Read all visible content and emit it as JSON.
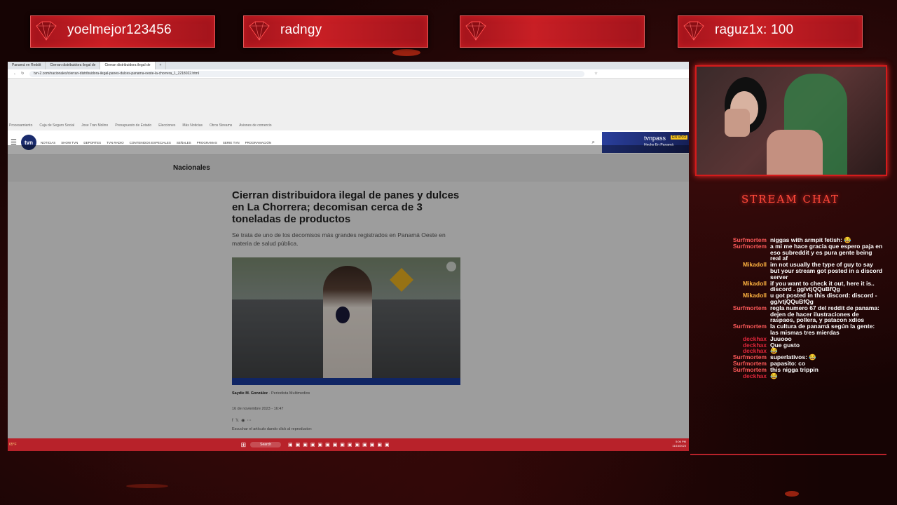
{
  "banners": [
    {
      "name": "yoelmejor123456"
    },
    {
      "name": "radngy"
    },
    {
      "name": ""
    },
    {
      "name": "raguz1x: 100"
    }
  ],
  "browser": {
    "tabs": [
      "Panamá en Reddit",
      "Cierran distribuidora ilegal de",
      "Cierran distribuidora ilegal de"
    ],
    "url": "tvn-2.com/nacionales/cierran-distribuidora-ilegal-panes-dulces-panama-oeste-la-chorrera_1_2218022.html",
    "bookmarks": [
      "Procesamiento",
      "Caja de Seguro Social",
      "Jose Tran Molino",
      "Presupuesto de Estado",
      "Elecciones",
      "Más Noticias",
      "Otros Streams",
      "Aviones de comercio"
    ],
    "nav_items": [
      "NOTICIAS",
      "SHOW TVN",
      "DEPORTES",
      "TVN RADIO",
      "CONTENIDOS ESPECIALES",
      "SEÑALES",
      "PROGRAMAS",
      "SERIE TVN",
      "PROGRAMACIÓN"
    ],
    "logo": "tvn",
    "tvnpass_label": "tvnpass",
    "tvnpass_badge": "EN VIVO",
    "tvnpass_sub": "Hecho En Panamá",
    "section": "Nacionales",
    "headline": "Cierran distribuidora ilegal de panes y dulces en La Chorrera; decomisan cerca de 3 toneladas de productos",
    "summary": "Se trata de uno de los decomisos más grandes registrados en Panamá Oeste en materia de salud pública.",
    "author": "Saydie M. González",
    "author_role": "Periodista Multimedios",
    "date": "16 de noviembre 2023 - 16:47",
    "listen": "Escuchar el artículo dando click al reproductor:",
    "taskbar_search": "Search",
    "weather": "65°F",
    "time": "5:06 PM",
    "date_short": "11/16/2023"
  },
  "chat": {
    "title": "STREAM CHAT",
    "messages": [
      {
        "user": "Surfmortem",
        "text": "niggas with armpit fetish: 😂",
        "color": "#ff5a5a"
      },
      {
        "user": "Surfmortem",
        "text": "a mi me hace gracia que espero paja en eso subreddit y es pura gente being real af",
        "color": "#ff5a5a"
      },
      {
        "user": "Mikadoll",
        "text": "im not usually the type of guy to say but your stream got posted in a discord server",
        "color": "#ffb340"
      },
      {
        "user": "Mikadoll",
        "text": "if you want to check it out, here it is.. discord . gg/vtjQQuBfQg",
        "color": "#ffb340"
      },
      {
        "user": "Mikadoll",
        "text": "u got posted in this discord: discord - gg/vtjQQuBfQg",
        "color": "#ffb340"
      },
      {
        "user": "Surfmortem",
        "text": "regla numero 67 del reddit de panama: dejen de hacer ilustraciones de raspaos, pollera, y patacon xdios",
        "color": "#ff5a5a"
      },
      {
        "user": "Surfmortem",
        "text": "la cultura de panamá según la gente: las mismas tres mierdas",
        "color": "#ff5a5a"
      },
      {
        "user": "deckhax",
        "text": "Juuooo",
        "color": "#e0263a"
      },
      {
        "user": "deckhax",
        "text": "Que gusto",
        "color": "#e0263a"
      },
      {
        "user": "deckhax",
        "text": "😂",
        "color": "#e0263a"
      },
      {
        "user": "Surfmortem",
        "text": "superlativos: 😂",
        "color": "#ff5a5a"
      },
      {
        "user": "Surfmortem",
        "text": "papasito: co",
        "color": "#ff5a5a"
      },
      {
        "user": "Surfmortem",
        "text": "this nigga trippin",
        "color": "#ff5a5a"
      },
      {
        "user": "deckhax",
        "text": "😂",
        "color": "#e0263a"
      }
    ]
  }
}
